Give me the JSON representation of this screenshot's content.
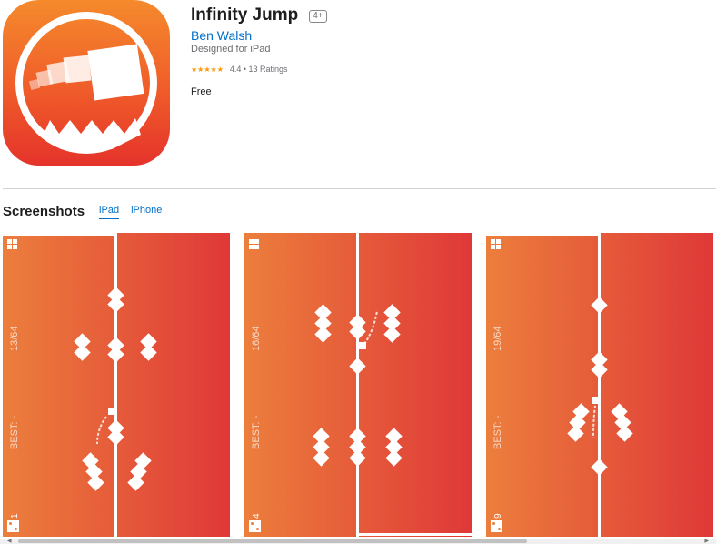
{
  "app": {
    "title": "Infinity Jump",
    "age_rating": "4+",
    "developer": "Ben Walsh",
    "designed_for": "Designed for iPad",
    "rating_stars": "★★★★★",
    "rating_text": "4.4 • 13 Ratings",
    "price": "Free",
    "icon_colors": {
      "top": "#f58a2c",
      "bottom": "#e5332b"
    }
  },
  "screenshots_section": {
    "title": "Screenshots",
    "tabs": [
      {
        "label": "iPad",
        "active": true
      },
      {
        "label": "iPhone",
        "active": false
      }
    ]
  },
  "screenshots": [
    {
      "score": "13/64",
      "best": "BEST: -",
      "counter": "1"
    },
    {
      "score": "16/64",
      "best": "BEST: -",
      "counter": "4"
    },
    {
      "score": "19/64",
      "best": "BEST: -",
      "counter": "9"
    }
  ],
  "theme": {
    "gradient_left": "#ec7e3c",
    "gradient_right": "#df3838"
  }
}
